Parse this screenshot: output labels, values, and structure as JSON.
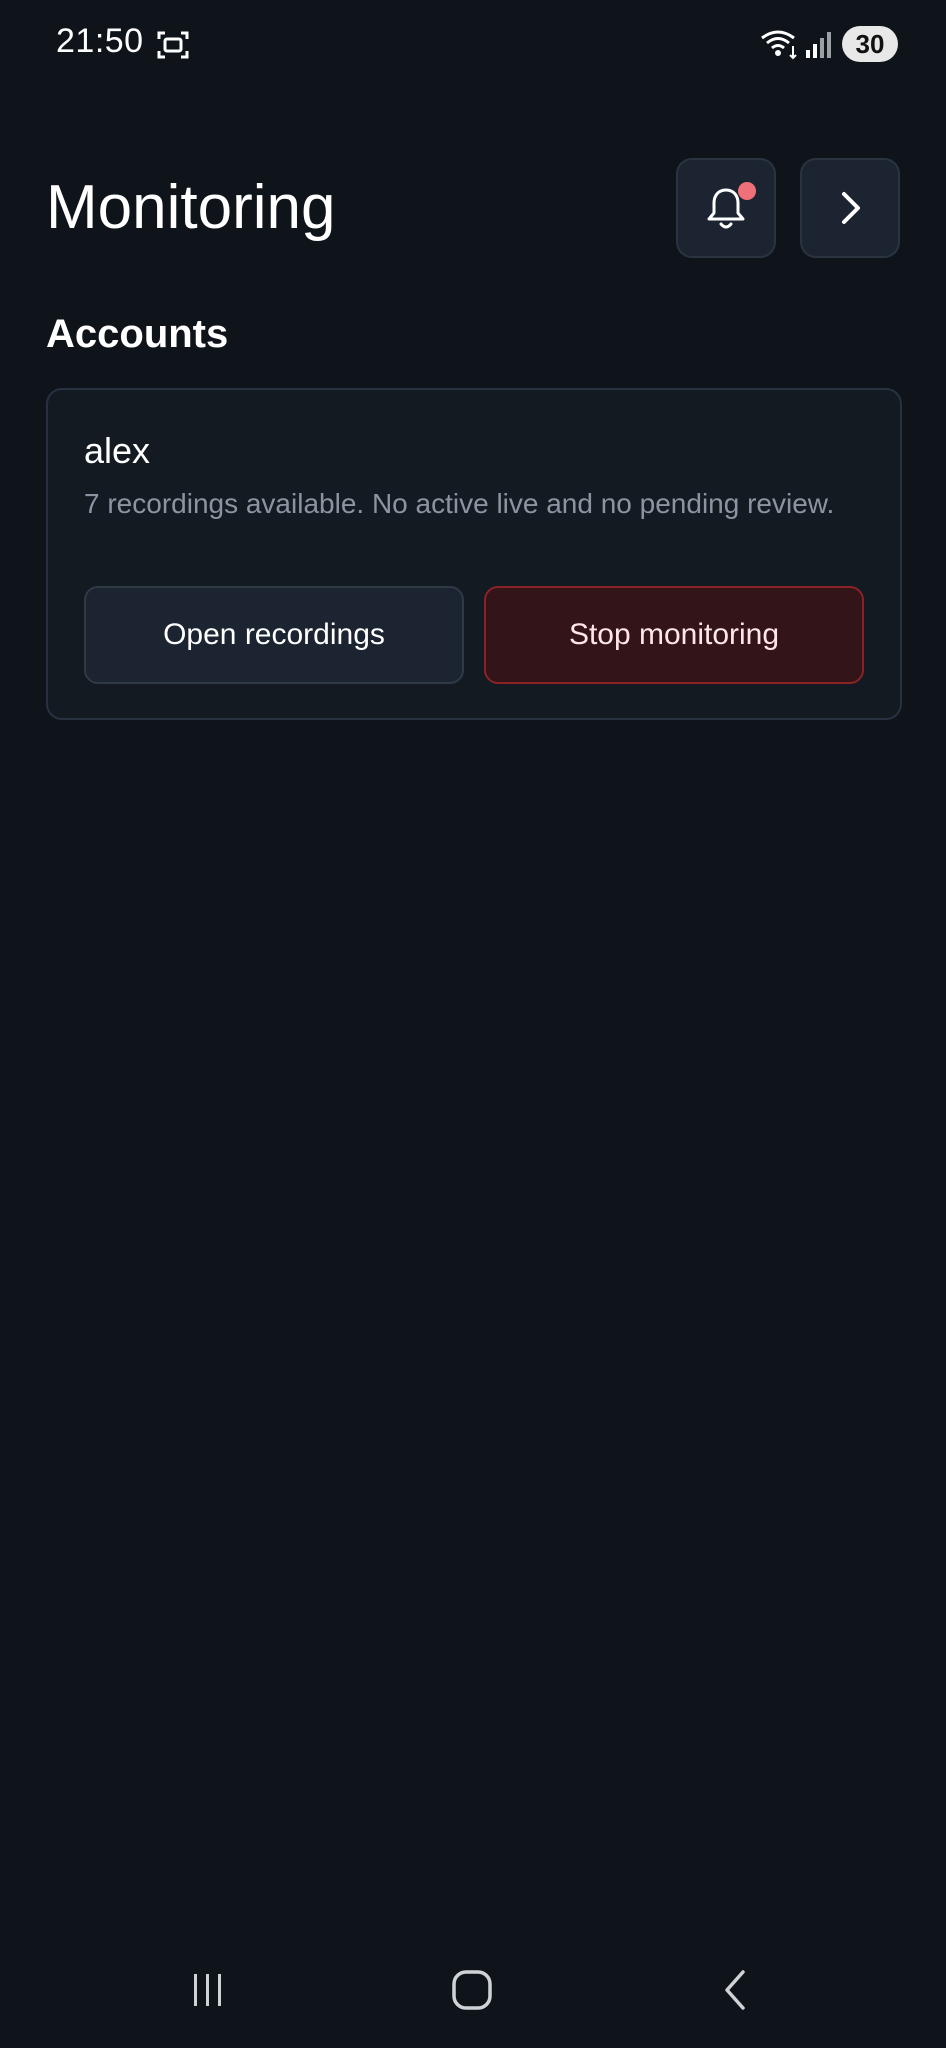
{
  "status_bar": {
    "time": "21:50",
    "battery": "30",
    "icons": [
      "screen-record-icon",
      "wifi-icon",
      "signal-icon"
    ]
  },
  "header": {
    "title": "Monitoring",
    "notifications_icon": "bell-icon",
    "has_unread_notifications": true,
    "next_icon": "chevron-right-icon"
  },
  "accounts": {
    "section_title": "Accounts",
    "items": [
      {
        "name": "alex",
        "status": "7 recordings available. No active live and no pending review.",
        "open_button_label": "Open recordings",
        "stop_button_label": "Stop monitoring"
      }
    ]
  },
  "nav": {
    "icons": [
      "recents-icon",
      "home-icon",
      "back-icon"
    ]
  },
  "colors": {
    "background": "#0f141a",
    "card": "#131a22",
    "danger_border": "#8a2226",
    "danger_fill": "#321419",
    "notification_dot": "#f0707a"
  }
}
